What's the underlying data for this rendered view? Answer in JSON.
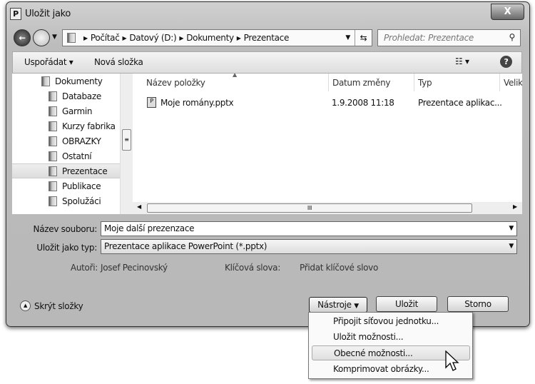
{
  "window": {
    "title": "Uložit jako",
    "close": "X",
    "app_icon": "P"
  },
  "address": {
    "segments": [
      "Počítač",
      "Datový (D:)",
      "Dokumenty",
      "Prezentace"
    ]
  },
  "search": {
    "placeholder": "Prohledat: Prezentace"
  },
  "toolbar": {
    "organize": "Uspořádat ▾",
    "new_folder": "Nová složka",
    "help": "?"
  },
  "sidebar": {
    "items": [
      {
        "label": "Dokumenty"
      },
      {
        "label": "Databaze"
      },
      {
        "label": "Garmin"
      },
      {
        "label": "Kurzy fabrika"
      },
      {
        "label": "OBRAZKY"
      },
      {
        "label": "Ostatní"
      },
      {
        "label": "Prezentace",
        "selected": true
      },
      {
        "label": "Publikace"
      },
      {
        "label": "Spolužáci"
      }
    ]
  },
  "files": {
    "columns": [
      "Název položky",
      "Datum změny",
      "Typ",
      "Velik"
    ],
    "rows": [
      {
        "name": "Moje romány.pptx",
        "date": "1.9.2008 11:18",
        "type": "Prezentace aplikac..."
      }
    ]
  },
  "form": {
    "filename_label": "Název souboru:",
    "filename": "Moje další prezenzace",
    "type_label": "Uložit jako typ:",
    "type": "Prezentace aplikace PowerPoint (*.pptx)",
    "authors_label": "Autoři:",
    "authors": "Josef Pecinovský",
    "keywords_label": "Klíčová slova:",
    "keywords": "Přidat klíčové slovo"
  },
  "footer": {
    "hide_folders": "Skrýt složky",
    "tools": "Nástroje",
    "save": "Uložit",
    "cancel": "Storno"
  },
  "tools_menu": {
    "items": [
      "Připojit síťovou jednotku...",
      "Uložit možnosti...",
      "Obecné možnosti...",
      "Komprimovat obrázky..."
    ],
    "highlighted": 2
  }
}
